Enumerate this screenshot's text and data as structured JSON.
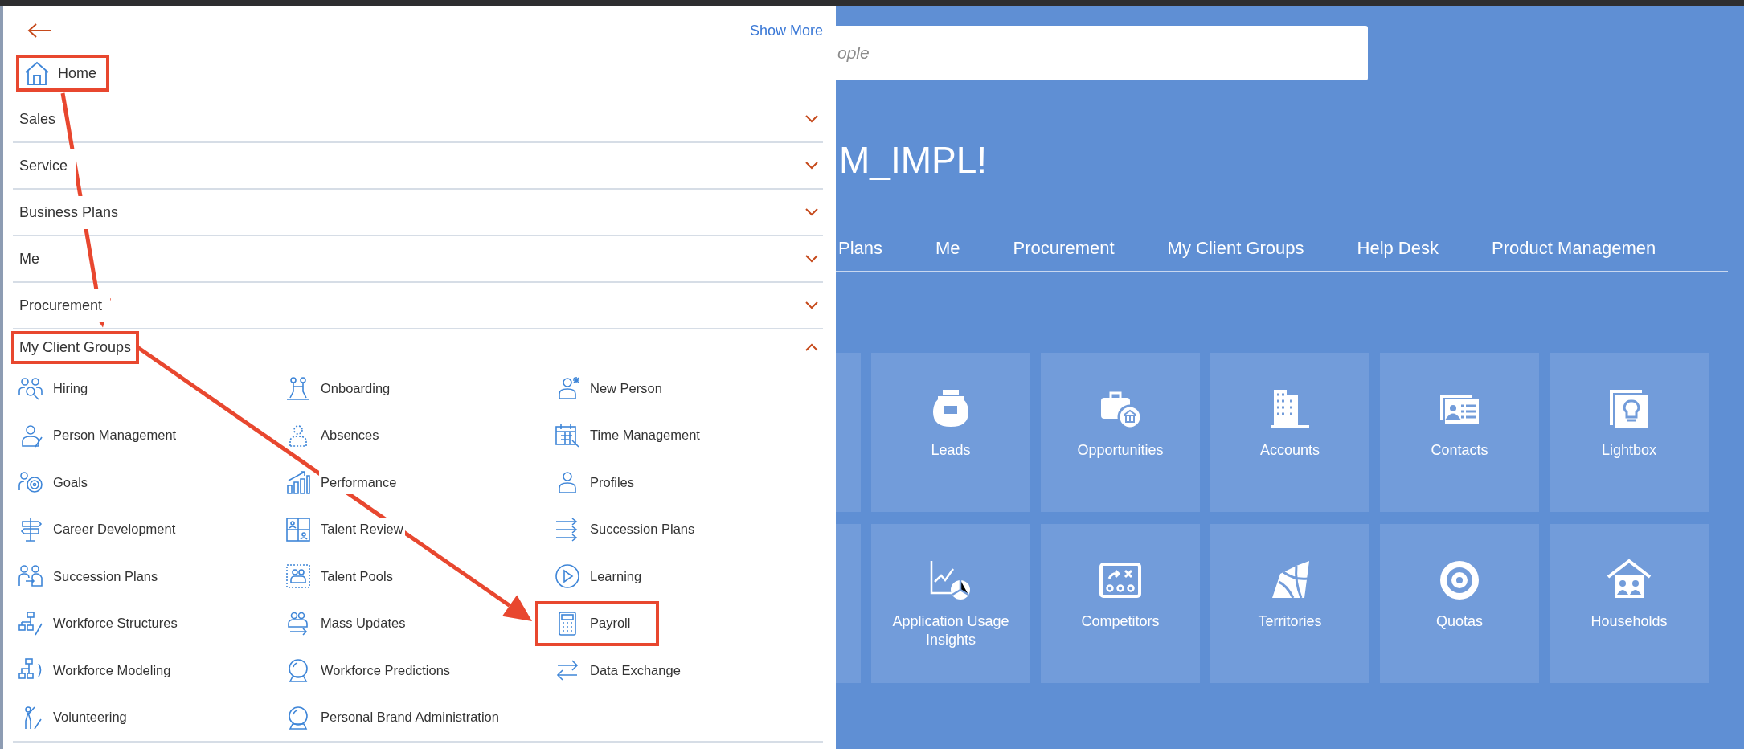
{
  "panel": {
    "show_more": "Show More",
    "home": {
      "label": "Home",
      "highlighted": true
    },
    "sections": [
      {
        "label": "Sales",
        "expanded": false,
        "highlighted": false
      },
      {
        "label": "Service",
        "expanded": false,
        "highlighted": false
      },
      {
        "label": "Business Plans",
        "expanded": false,
        "highlighted": false
      },
      {
        "label": "Me",
        "expanded": false,
        "highlighted": false
      },
      {
        "label": "Procurement",
        "expanded": false,
        "highlighted": false
      },
      {
        "label": "My Client Groups",
        "expanded": true,
        "highlighted": true,
        "items": [
          {
            "label": "Hiring",
            "highlighted": false
          },
          {
            "label": "Onboarding",
            "highlighted": false
          },
          {
            "label": "New Person",
            "highlighted": false
          },
          {
            "label": "Person Management",
            "highlighted": false
          },
          {
            "label": "Absences",
            "highlighted": false
          },
          {
            "label": "Time Management",
            "highlighted": false
          },
          {
            "label": "Goals",
            "highlighted": false
          },
          {
            "label": "Performance",
            "highlighted": false
          },
          {
            "label": "Profiles",
            "highlighted": false
          },
          {
            "label": "Career Development",
            "highlighted": false
          },
          {
            "label": "Talent Review",
            "highlighted": false
          },
          {
            "label": "Succession Plans",
            "highlighted": false
          },
          {
            "label": "Succession Plans",
            "highlighted": false
          },
          {
            "label": "Talent Pools",
            "highlighted": false
          },
          {
            "label": "Learning",
            "highlighted": false
          },
          {
            "label": "Workforce Structures",
            "highlighted": false
          },
          {
            "label": "Mass Updates",
            "highlighted": false
          },
          {
            "label": "Payroll",
            "highlighted": true
          },
          {
            "label": "Workforce Modeling",
            "highlighted": false
          },
          {
            "label": "Workforce Predictions",
            "highlighted": false
          },
          {
            "label": "Data Exchange",
            "highlighted": false
          },
          {
            "label": "Volunteering",
            "highlighted": false
          },
          {
            "label": "Personal Brand Administration",
            "highlighted": false
          }
        ]
      }
    ]
  },
  "search": {
    "placeholder": "ople"
  },
  "greeting": "M_IMPL!",
  "tabs": [
    {
      "label": "Plans",
      "selected": false
    },
    {
      "label": "Me",
      "selected": false
    },
    {
      "label": "Procurement",
      "selected": false
    },
    {
      "label": "My Client Groups",
      "selected": false
    },
    {
      "label": "Help Desk",
      "selected": false
    },
    {
      "label": "Product Managemen",
      "selected": false
    }
  ],
  "tile_rows": [
    {
      "tiles": [
        "Leads",
        "Opportunities",
        "Accounts",
        "Contacts",
        "Lightbox"
      ]
    },
    {
      "tiles": [
        "Application Usage Insights",
        "Competitors",
        "Territories",
        "Quotas",
        "Households"
      ]
    }
  ]
}
